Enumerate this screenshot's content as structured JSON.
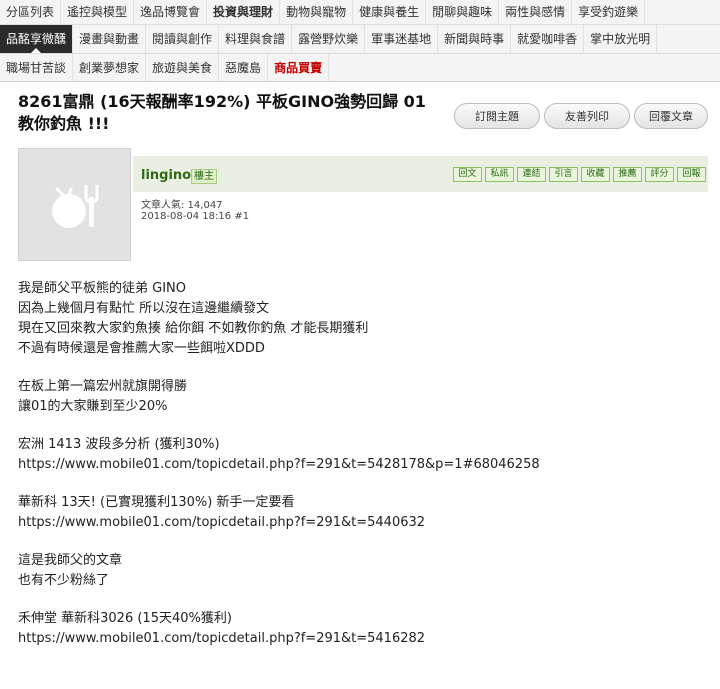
{
  "nav": {
    "row1": [
      "分區列表",
      "遙控與模型",
      "逸品博覽會",
      "投資與理財",
      "動物與寵物",
      "健康與養生",
      "閒聊與趣味",
      "兩性與感情",
      "享受釣遊樂"
    ],
    "row2": [
      "品酩享微醺",
      "漫畫與動畫",
      "閱讀與創作",
      "料理與食譜",
      "露營野炊樂",
      "軍事迷基地",
      "新聞與時事",
      "就愛咖啡香",
      "掌中放光明"
    ],
    "row3": [
      "職場甘苦談",
      "創業夢想家",
      "旅遊與美食",
      "惡魔島",
      "商品買賣"
    ]
  },
  "thread": {
    "title": "8261富鼎 (16天報酬率192%) 平板GINO強勢回歸 01 教你釣魚 !!!",
    "actions": [
      "訂閱主題",
      "友善列印",
      "回覆文章"
    ]
  },
  "post": {
    "author": "lingino",
    "role": "樓主",
    "buttons": [
      "回文",
      "私訊",
      "連結",
      "引言",
      "收藏",
      "推薦",
      "評分",
      "回報"
    ],
    "popularity": "文章人氣: 14,047",
    "datetime": "2018-08-04 18:16",
    "floor": "#1",
    "lines": [
      "我是師父平板熊的徒弟 GINO",
      "因為上幾個月有點忙 所以沒在這邊繼續發文",
      "現在又回來教大家釣魚揍 給你餌 不如教你釣魚 才能長期獲利",
      "不過有時候還是會推薦大家一些餌啦XDDD",
      "",
      "在板上第一篇宏州就旗開得勝",
      "讓01的大家賺到至少20%",
      "",
      "宏洲 1413 波段多分析 (獲利30%)",
      "https://www.mobile01.com/topicdetail.php?f=291&t=5428178&p=1#68046258",
      "",
      "華新科 13天! (已實現獲利130%) 新手一定要看",
      "https://www.mobile01.com/topicdetail.php?f=291&t=5440632",
      "",
      "這是我師父的文章",
      "也有不少粉絲了",
      "",
      "禾伸堂 華新科3026 (15天40%獲利)",
      "https://www.mobile01.com/topicdetail.php?f=291&t=5416282"
    ]
  }
}
